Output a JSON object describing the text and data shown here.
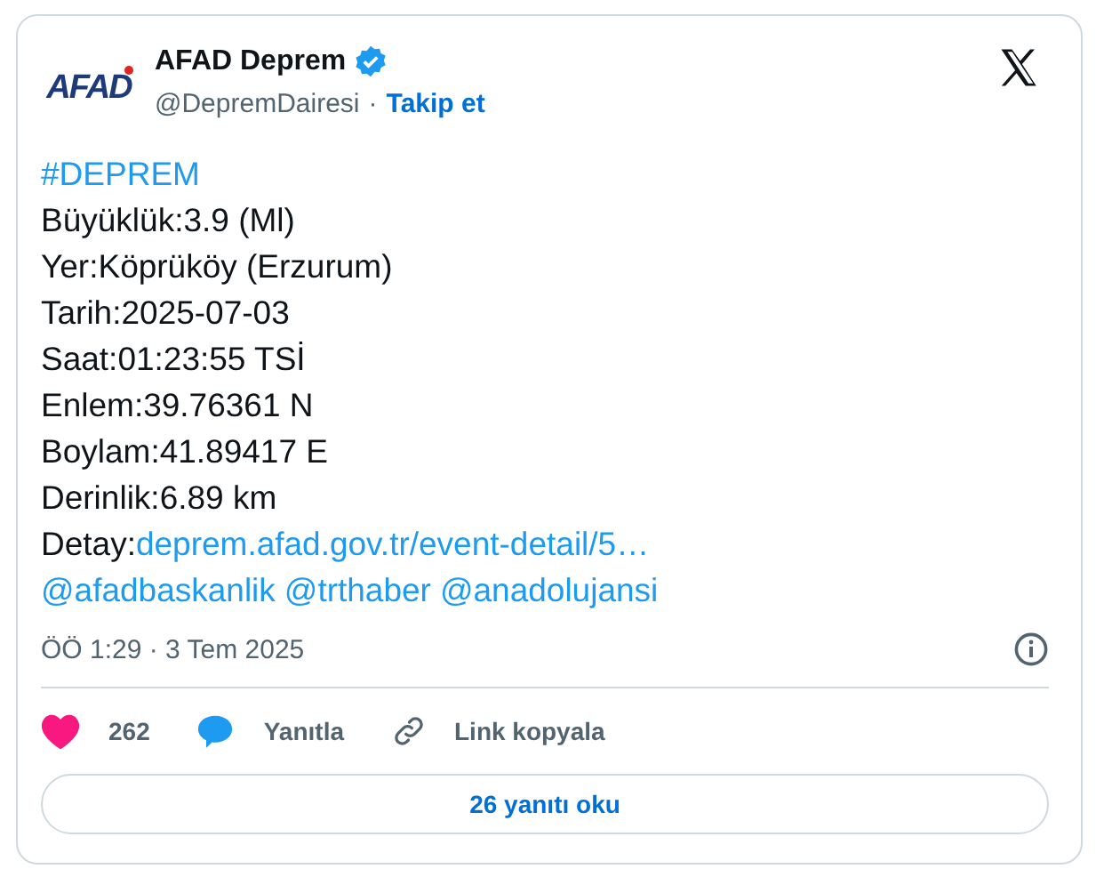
{
  "author": {
    "logo": "AFAD",
    "name": "AFAD Deprem",
    "verified": true,
    "handle": "@DepremDairesi",
    "separator": "·",
    "follow": "Takip et"
  },
  "body": [
    [
      {
        "text": "#DEPREM",
        "link": true
      }
    ],
    [
      {
        "text": "Büyüklük:3.9 (Ml)",
        "link": false
      }
    ],
    [
      {
        "text": "Yer:Köprüköy (Erzurum)",
        "link": false
      }
    ],
    [
      {
        "text": "Tarih:2025-07-03",
        "link": false
      }
    ],
    [
      {
        "text": "Saat:01:23:55 TSİ",
        "link": false
      }
    ],
    [
      {
        "text": "Enlem:39.76361 N",
        "link": false
      }
    ],
    [
      {
        "text": "Boylam:41.89417 E",
        "link": false
      }
    ],
    [
      {
        "text": "Derinlik:6.89 km",
        "link": false
      }
    ],
    [
      {
        "text": "Detay:",
        "link": false
      },
      {
        "text": "deprem.afad.gov.tr/event-detail/5…",
        "link": true
      }
    ],
    [
      {
        "text": "@afadbaskanlik",
        "link": true
      },
      {
        "text": "@trthaber",
        "link": true
      },
      {
        "text": "@anadolujansi",
        "link": true
      }
    ]
  ],
  "timestamp": "ÖÖ 1:29 · 3 Tem 2025",
  "actions": {
    "liked": true,
    "likes": "262",
    "reply": "Yanıtla",
    "copy_link": "Link kopyala"
  },
  "read_replies": "26 yanıtı oku"
}
